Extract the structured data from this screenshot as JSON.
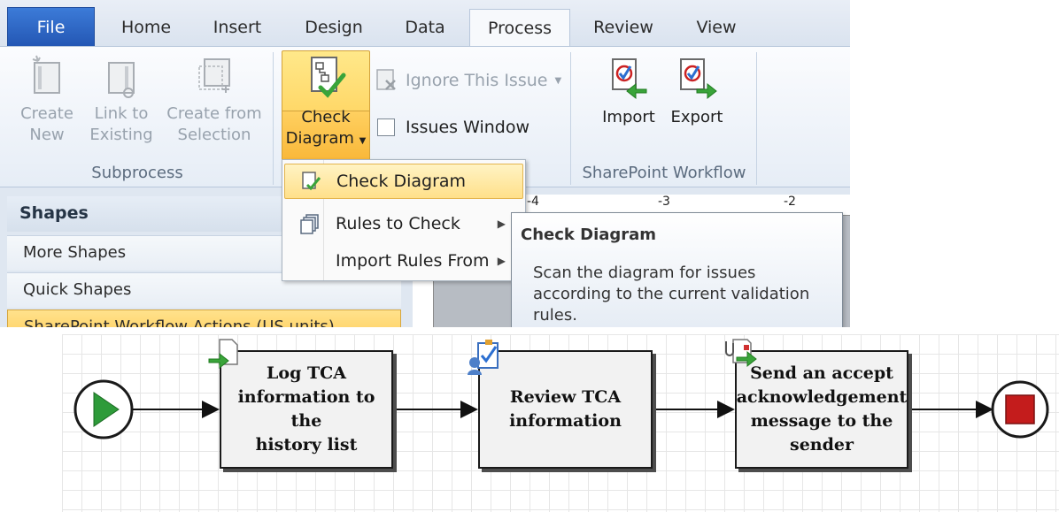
{
  "tabs": [
    {
      "label": "File"
    },
    {
      "label": "Home"
    },
    {
      "label": "Insert"
    },
    {
      "label": "Design"
    },
    {
      "label": "Data"
    },
    {
      "label": "Process"
    },
    {
      "label": "Review"
    },
    {
      "label": "View"
    }
  ],
  "subprocess": {
    "group_label": "Subprocess",
    "create_new": {
      "line1": "Create",
      "line2": "New"
    },
    "link_to_existing": {
      "line1": "Link to",
      "line2": "Existing"
    },
    "create_from_selection": {
      "line1": "Create from",
      "line2": "Selection"
    }
  },
  "diagram_validation": {
    "check_diagram": {
      "line1": "Check",
      "line2": "Diagram"
    },
    "ignore_issue": "Ignore This Issue",
    "issues_window": "Issues Window"
  },
  "sharepoint": {
    "group_label": "SharePoint Workflow",
    "import": "Import",
    "export": "Export"
  },
  "menu": {
    "items": [
      {
        "label": "Check Diagram"
      },
      {
        "label": "Rules to Check"
      },
      {
        "label": "Import Rules From"
      }
    ]
  },
  "tooltip": {
    "title": "Check Diagram",
    "body": "Scan the diagram for issues according to the current validation rules."
  },
  "shapes_pane": {
    "header": "Shapes",
    "items": [
      {
        "label": "More Shapes"
      },
      {
        "label": "Quick Shapes"
      },
      {
        "label": "SharePoint Workflow Actions (US units)"
      }
    ]
  },
  "ruler": {
    "ticks": [
      "-4",
      "-3",
      "-2"
    ]
  },
  "workflow": {
    "steps": [
      {
        "lines": [
          "Log TCA",
          "information to the",
          "history list"
        ]
      },
      {
        "lines": [
          "Review TCA",
          "information"
        ]
      },
      {
        "lines": [
          "Send an accept",
          "acknowledgement",
          "message to the",
          "sender"
        ]
      }
    ]
  },
  "colors": {
    "accent_highlight": "#ffd35c",
    "file_tab": "#2b61c1",
    "start_green": "#2e9b3a",
    "stop_red": "#c41c1c"
  }
}
